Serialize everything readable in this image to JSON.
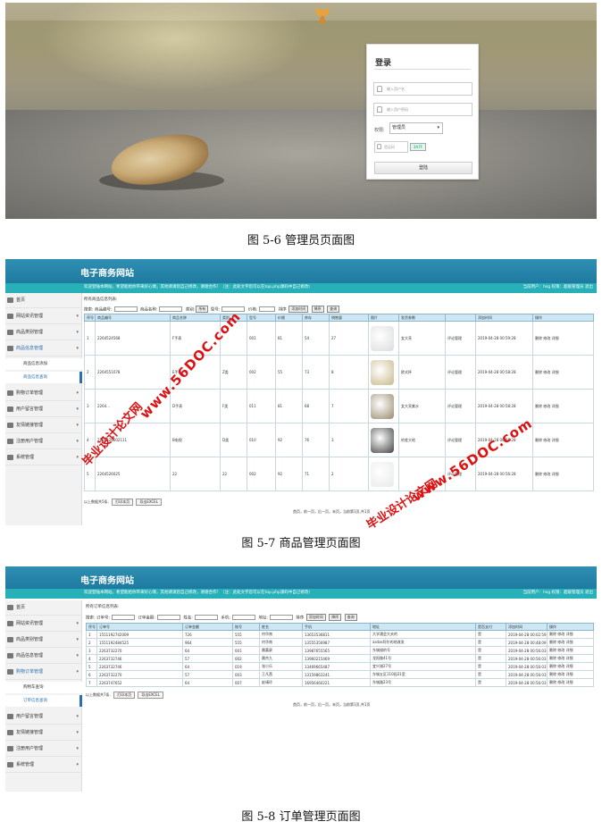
{
  "figure1": {
    "login": {
      "title": "登录",
      "username_placeholder": "输入用户名",
      "password_placeholder": "输入用户密码",
      "role_label": "权限:",
      "role_value": "管理员",
      "captcha_placeholder": "验证码",
      "captcha_code": "3A7F",
      "submit_label": "登陆"
    },
    "caption": "图 5-6  管理员页面图"
  },
  "figure2": {
    "site_title": "电子商务网站",
    "notice": "欢迎登陆本网站，希望能给你带来好心情，其他请请您自己修改，谢谢合作！（注：此处文字您可以在top.php源码中自己修改）",
    "user_info": "当前用户：hsg  权限：超级管理员  退出",
    "menu": [
      {
        "label": "首页",
        "icon": "home-icon"
      },
      {
        "label": "网站资讯管理",
        "icon": "grid-icon"
      },
      {
        "label": "商品类别管理",
        "icon": "car-icon"
      },
      {
        "label": "商品信息管理",
        "icon": "car-icon"
      },
      {
        "label": "购物订单管理",
        "icon": "user-icon"
      },
      {
        "label": "用户留言管理",
        "icon": "users-icon"
      },
      {
        "label": "友情链接管理",
        "icon": "heart-icon"
      },
      {
        "label": "注册用户管理",
        "icon": "device-icon"
      },
      {
        "label": "系统管理",
        "icon": "tools-icon"
      }
    ],
    "submenu": [
      "商品信息添加",
      "商品信息查询"
    ],
    "content_label": "所有商品信息列表:",
    "search": {
      "prefix": "搜索:",
      "field1": "商品编号:",
      "field2": "商品名称:",
      "field3": "类别:",
      "field3_value": "所有",
      "field4": "型号:",
      "field5": "价格:",
      "field6": "排序",
      "sort_value": "添加时间",
      "order_value": "降序",
      "button": "查询"
    },
    "columns": [
      "序号",
      "商品编号",
      "商品名称",
      "类别",
      "型号",
      "价格",
      "库存",
      "销售量",
      "图片",
      "发货参数",
      "",
      "添加时间",
      "操作"
    ],
    "rows": [
      [
        "1",
        "2264524568",
        "F手表",
        "",
        "001",
        "81",
        "54",
        "27",
        "",
        "女大亮",
        "评论管理",
        "2019-04-28 00:59:28",
        "删除  修改  详细"
      ],
      [
        "2",
        "2264551078",
        "E手表",
        "Z类",
        "002",
        "55",
        "73",
        "8",
        "",
        "欧式杯",
        "评论管理",
        "2019-04-28 00:58:28",
        "删除  修改  详细"
      ],
      [
        "3",
        "2264...",
        "D手表",
        "F类",
        "011",
        "81",
        "68",
        "7",
        "",
        "女大亮紫水",
        "评论管理",
        "2019-04-28 00:58:28",
        "删除  修改  详细"
      ],
      [
        "4",
        "2264520602111",
        "B电视",
        "D类",
        "010",
        "92",
        "76",
        "3",
        "",
        "的差大地",
        "评论管理",
        "2019-04-28 00:56:28",
        "删除  修改  详细"
      ],
      [
        "5",
        "2264526025",
        "22",
        "22",
        "002",
        "92",
        "71",
        "2",
        "",
        "",
        "评论管理",
        "2019-04-28 00:56:28",
        "删除  修改  详细"
      ]
    ],
    "footer_label": "以上数据共5条,",
    "footer_btn1": "打印本页",
    "footer_btn2": "导出EXCEL",
    "pager": "首页，前一页，后一页，末页，当前第1页,共1页",
    "caption": "图 5-7  商品管理页面图"
  },
  "figure3": {
    "site_title": "电子商务网站",
    "notice": "欢迎登陆本网站，希望能给你带来好心情，其他请请您自己修改，谢谢合作！（注：此处文字您可以在top.php源码中自己修改）",
    "user_info": "当前用户：hsg  权限：超级管理员  退出",
    "menu": [
      {
        "label": "首页",
        "icon": "home-icon"
      },
      {
        "label": "网站资讯管理",
        "icon": "grid-icon"
      },
      {
        "label": "商品类别管理",
        "icon": "car-icon"
      },
      {
        "label": "商品信息管理",
        "icon": "car-icon"
      },
      {
        "label": "购物订单管理",
        "icon": "user-icon"
      },
      {
        "label": "用户留言管理",
        "icon": "users-icon"
      },
      {
        "label": "友情链接管理",
        "icon": "heart-icon"
      },
      {
        "label": "注册用户管理",
        "icon": "device-icon"
      },
      {
        "label": "系统管理",
        "icon": "tools-icon"
      }
    ],
    "submenu": [
      "购物车查询",
      "订单信息查询"
    ],
    "content_label": "所有订单信息列表:",
    "search": {
      "prefix": "搜索:",
      "field1": "订单号:",
      "field2": "订单金额:",
      "field3": "姓名:",
      "field4": "手机:",
      "field5": "地址:",
      "field6": "排序",
      "sort_value": "添加时间",
      "order_value": "降序",
      "button": "查询"
    },
    "columns": [
      "序号",
      "订单号",
      "订单金额",
      "账号",
      "姓名",
      "手机",
      "地址",
      "是否支付",
      "添加时间",
      "操作"
    ],
    "rows": [
      [
        "1",
        "1551192742009",
        "726",
        "555",
        "何华南",
        "13653536811",
        "大学通会大夫的",
        "是",
        "2019-04-28 00:02:59",
        "删除  修改  详细"
      ],
      [
        "2",
        "1551192484525",
        "964",
        "555",
        "何华南",
        "13555356987",
        "asdas阿尔的地改发",
        "是",
        "2019-04-28 00:48:09",
        "删除  修改  详细"
      ],
      [
        "3",
        "2263732270",
        "64",
        "001",
        "晨嘉豪",
        "13987655565",
        "东城描的号",
        "是",
        "2019-04-28 00:56:03",
        "删除  修改  详细"
      ],
      [
        "4",
        "2263732746",
        "57",
        "002",
        "晨杰九",
        "13960215469",
        "龙阳路41号",
        "是",
        "2019-04-28 00:56:03",
        "删除  修改  详细"
      ],
      [
        "5",
        "2263732746",
        "64",
        "019",
        "张小乐",
        "13469665487",
        "宜兴湖27号",
        "是",
        "2019-04-28 00:56:03",
        "删除  修改  详细"
      ],
      [
        "6",
        "2263732270",
        "57",
        "003",
        "王凡茜",
        "13159863241",
        "东城五区110园31室",
        "是",
        "2019-04-28 00:56:03",
        "删除  修改  详细"
      ],
      [
        "7",
        "2263747652",
        "64",
        "007",
        "赵靖玲",
        "16956460221",
        "东城路23号",
        "是",
        "2019-04-28 00:56:03",
        "删除  修改  详细"
      ]
    ],
    "footer_label": "以上数据共7条,",
    "footer_btn1": "打印本页",
    "footer_btn2": "导出EXCEL",
    "pager": "首页，前一页，后一页，末页，当前第1页,共1页",
    "caption": "图 5-8 订单管理页面图"
  },
  "watermarks": {
    "line1": "毕业设计论文网",
    "line2": "www.56DOC.com"
  },
  "colors": {
    "header_blue": "#1f7aa0",
    "notice_teal": "#27b0b8",
    "table_header": "#cde8f4",
    "watermark_red": "#dd1111"
  }
}
